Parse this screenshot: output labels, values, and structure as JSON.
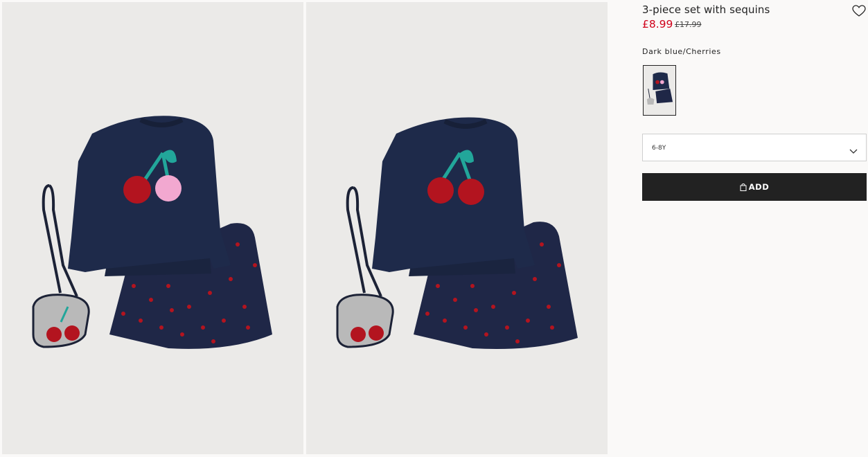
{
  "product": {
    "title": "3-piece set with sequins",
    "price": "£8.99",
    "old_price": "£17.99",
    "colour_label": "Dark blue/Cherries",
    "size_selected": "6-8Y",
    "add_label": "ADD"
  },
  "icons": {
    "favourite": "heart-icon",
    "dropdown": "chevron-down-icon",
    "bag": "shopping-bag-icon"
  },
  "colors": {
    "sale_price": "#d0021b",
    "button_bg": "#222222",
    "sweater": "#1e2a4a",
    "cherry_red": "#b3141f",
    "leaf_teal": "#22a69a"
  }
}
